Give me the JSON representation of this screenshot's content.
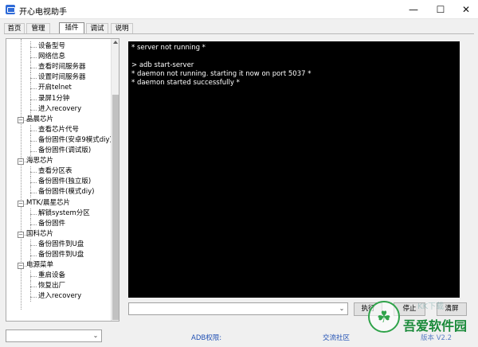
{
  "window": {
    "title": "开心电视助手",
    "controls": {
      "minimize": "—",
      "maximize": "☐",
      "close": "✕"
    }
  },
  "tabs": [
    {
      "label": "首页",
      "active": false
    },
    {
      "label": "管理",
      "active": false
    },
    {
      "label": "插件",
      "active": true
    },
    {
      "label": "调试",
      "active": false
    },
    {
      "label": "说明",
      "active": false
    }
  ],
  "tree": {
    "items": [
      {
        "label": "设备型号",
        "level": 1
      },
      {
        "label": "网络信息",
        "level": 1
      },
      {
        "label": "查看时间服务器",
        "level": 1
      },
      {
        "label": "设置时间服务器",
        "level": 1
      },
      {
        "label": "开启telnet",
        "level": 1
      },
      {
        "label": "录屏1分钟",
        "level": 1
      },
      {
        "label": "进入recovery",
        "level": 1
      },
      {
        "label": "晶晨芯片",
        "level": 0,
        "expanded": true
      },
      {
        "label": "查看芯片代号",
        "level": 1
      },
      {
        "label": "备份固件(安卓9模式diy)",
        "level": 1
      },
      {
        "label": "备份固件(调试版)",
        "level": 1
      },
      {
        "label": "海思芯片",
        "level": 0,
        "expanded": true
      },
      {
        "label": "查看分区表",
        "level": 1
      },
      {
        "label": "备份固件(独立版)",
        "level": 1
      },
      {
        "label": "备份固件(模式diy)",
        "level": 1
      },
      {
        "label": "MTK/晨星芯片",
        "level": 0,
        "expanded": true
      },
      {
        "label": "解锁system分区",
        "level": 1
      },
      {
        "label": "备份固件",
        "level": 1
      },
      {
        "label": "国科芯片",
        "level": 0,
        "expanded": true
      },
      {
        "label": "备份固件到U盘",
        "level": 1
      },
      {
        "label": "备份固件到U盘",
        "level": 1
      },
      {
        "label": "电源菜单",
        "level": 0,
        "expanded": true
      },
      {
        "label": "重启设备",
        "level": 1
      },
      {
        "label": "恢复出厂",
        "level": 1
      },
      {
        "label": "进入recovery",
        "level": 1
      }
    ],
    "expander_glyph": "−"
  },
  "console": {
    "lines": [
      "* server not running *",
      "",
      "> adb start-server",
      "* daemon not running. starting it now on port 5037 *",
      "* daemon started successfully *"
    ]
  },
  "command": {
    "value": "",
    "dropdown_glyph": "⌄"
  },
  "buttons": {
    "execute": "执行",
    "stop": "停止",
    "clear": "清屏"
  },
  "status": {
    "select_value": "",
    "adb_permission": "ADB权限:",
    "community": "交流社区",
    "version": "版本 V2.2"
  },
  "watermark": {
    "text": "吾爱软件园",
    "glyph": "☘",
    "small": "KK下载"
  },
  "colors": {
    "console_bg": "#000000",
    "console_fg": "#ffffff",
    "link": "#1f4fb3",
    "watermark": "#1a8a3a"
  }
}
